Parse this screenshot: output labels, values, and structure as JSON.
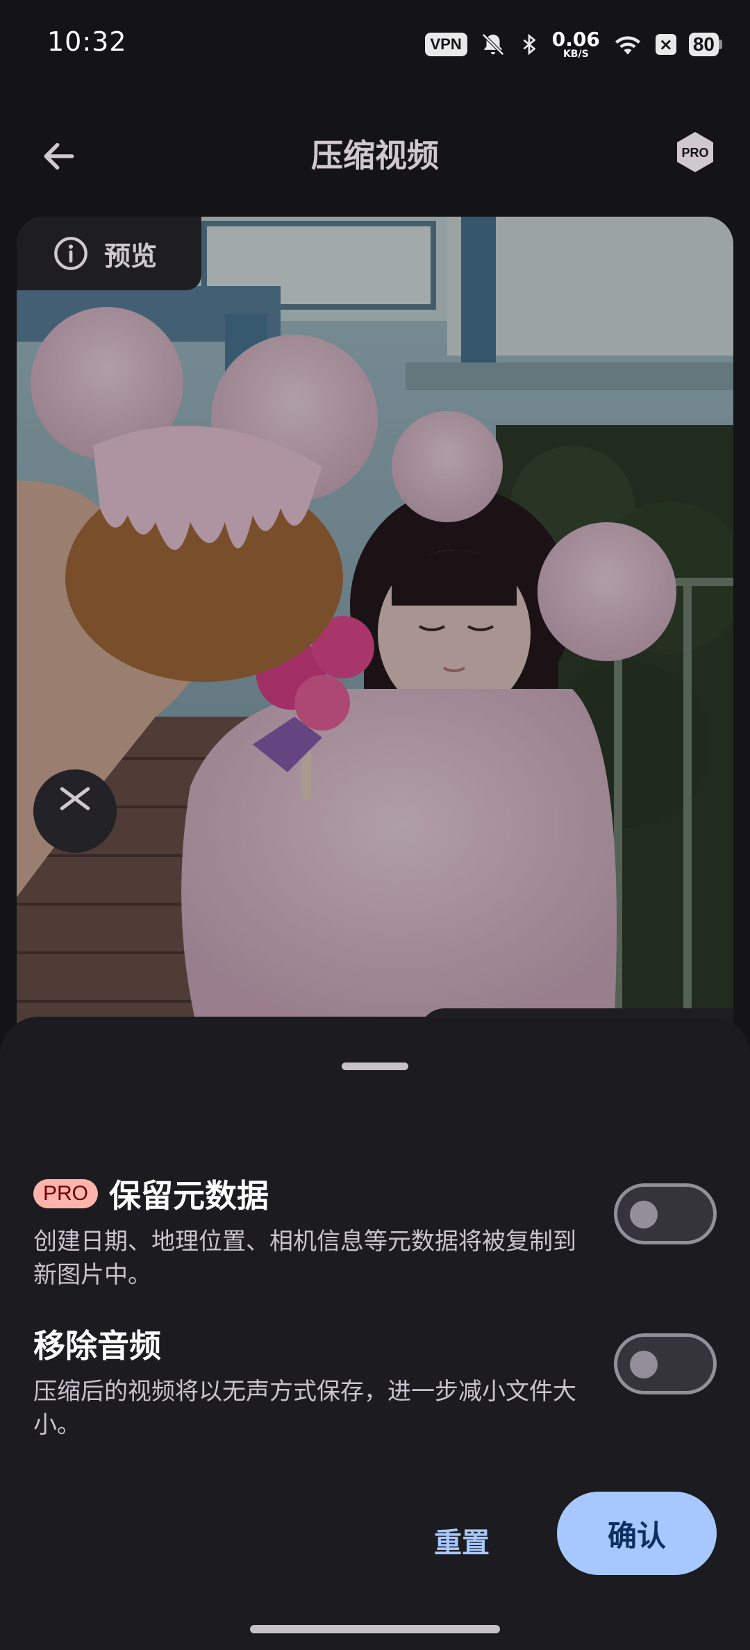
{
  "status_bar": {
    "time": "10:32",
    "vpn": "VPN",
    "net_speed": "0.06",
    "net_unit": "KB/S",
    "battery": "80",
    "icons": [
      "vpn-icon",
      "bell-off-icon",
      "bluetooth-icon",
      "wifi-icon",
      "x-box-icon",
      "battery-icon"
    ]
  },
  "app_bar": {
    "title": "压缩视频",
    "back_icon": "arrow-left-icon",
    "pro_badge": "PRO"
  },
  "preview": {
    "tag_label": "预览",
    "info_icon": "info-icon",
    "trim_icon": "scissors-icon"
  },
  "sheet": {
    "options": [
      {
        "badge": "PRO",
        "title": "保留元数据",
        "description": "创建日期、地理位置、相机信息等元数据将被复制到新图片中。",
        "enabled": false
      },
      {
        "title": "移除音频",
        "description": "压缩后的视频将以无声方式保存，进一步减小文件大小。",
        "enabled": false
      }
    ],
    "reset_label": "重置",
    "confirm_label": "确认"
  },
  "colors": {
    "background": "#141316",
    "sheet": "#1c1b1f",
    "accent": "#a7c8ff",
    "pro_chip": "#ffb4ab"
  }
}
